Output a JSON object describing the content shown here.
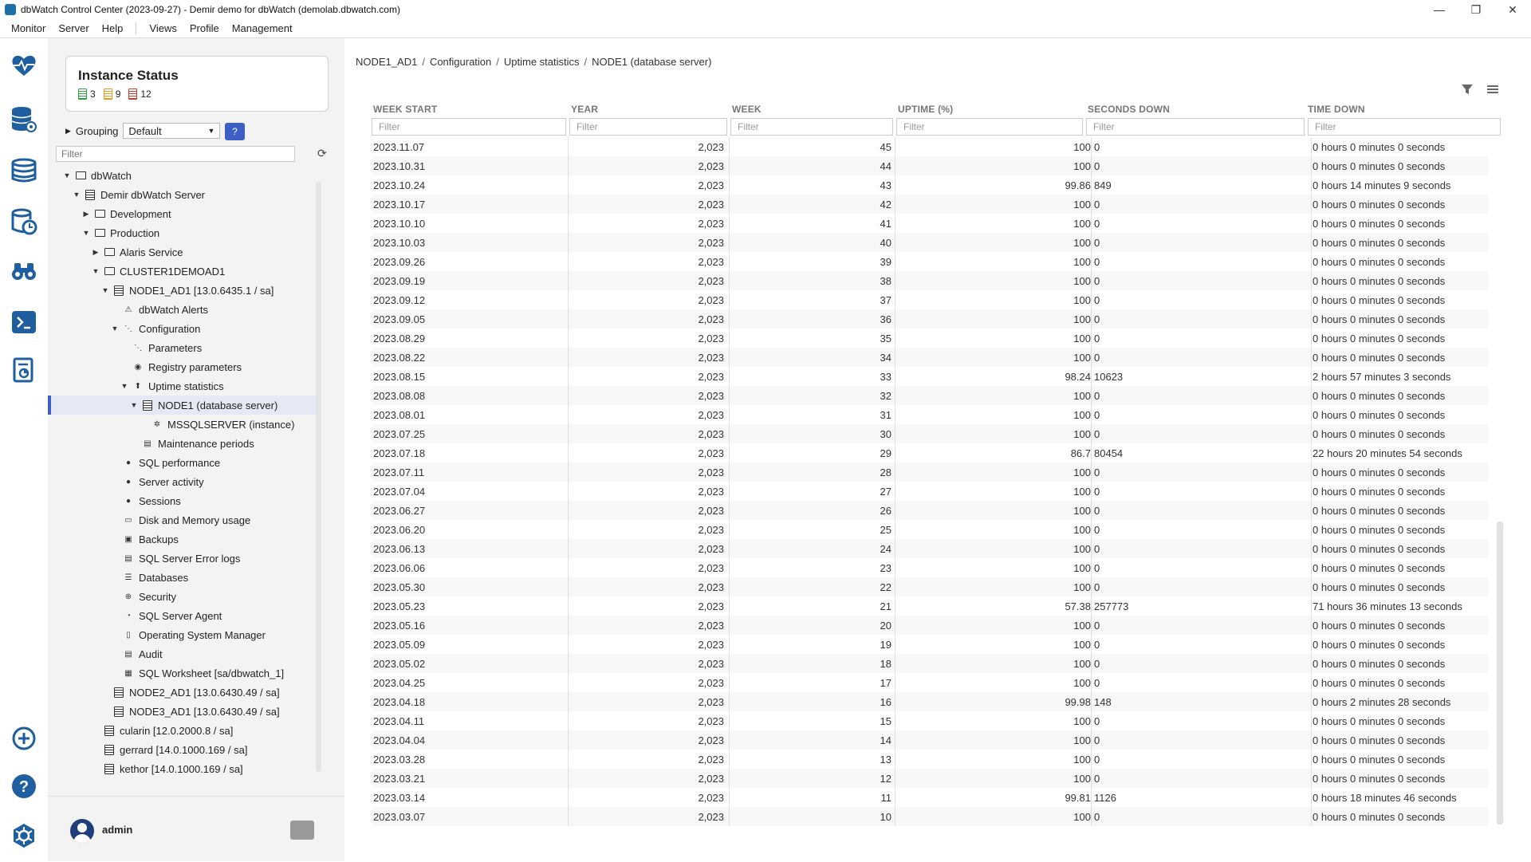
{
  "window": {
    "title": "dbWatch Control Center  (2023-09-27) - Demir demo for dbWatch (demolab.dbwatch.com)",
    "controls": [
      "—",
      "❐",
      "✕"
    ]
  },
  "menubar": {
    "items": [
      "Monitor",
      "Server",
      "Help"
    ],
    "items2": [
      "Views",
      "Profile",
      "Management"
    ]
  },
  "rail_icons": [
    "heartbeat-icon",
    "database-settings-icon",
    "database-stack-icon",
    "database-clock-icon",
    "binoculars-icon",
    "terminal-icon",
    "report-icon",
    "add-icon",
    "help-icon",
    "hexagon-settings-icon"
  ],
  "instance_status": {
    "title": "Instance Status",
    "green_count": "3",
    "orange_count": "9",
    "red_count": "12",
    "colors": {
      "green": "#2e9e44",
      "orange": "#e89a1c",
      "red": "#d33b2c"
    }
  },
  "grouping": {
    "label": "Grouping",
    "selected": "Default",
    "help_label": "?"
  },
  "tree_filter": {
    "placeholder": "Filter"
  },
  "tree": [
    {
      "label": "dbWatch",
      "arrow": "▼",
      "icon": "folder"
    },
    {
      "label": "Demir dbWatch Server",
      "arrow": "▼",
      "icon": "db"
    },
    {
      "label": "Development",
      "arrow": "▶",
      "icon": "folder"
    },
    {
      "label": "Production",
      "arrow": "▼",
      "icon": "folder"
    },
    {
      "label": "Alaris Service",
      "arrow": "▶",
      "icon": "cluster"
    },
    {
      "label": "CLUSTER1DEMOAD1",
      "arrow": "▼",
      "icon": "cluster"
    },
    {
      "label": "NODE1_AD1 [13.0.6435.1 / sa]",
      "arrow": "▼",
      "icon": "db"
    },
    {
      "label": "dbWatch Alerts",
      "arrow": "",
      "icon": "alert"
    },
    {
      "label": "Configuration",
      "arrow": "▼",
      "icon": "config"
    },
    {
      "label": "Parameters",
      "arrow": "",
      "icon": "config"
    },
    {
      "label": "Registry parameters",
      "arrow": "",
      "icon": "registry"
    },
    {
      "label": "Uptime statistics",
      "arrow": "▼",
      "icon": "uptime"
    },
    {
      "label": "NODE1 (database server)",
      "arrow": "▼",
      "icon": "db"
    },
    {
      "label": "MSSQLSERVER (instance)",
      "arrow": "",
      "icon": "gear"
    },
    {
      "label": "Maintenance periods",
      "arrow": "",
      "icon": "doc"
    },
    {
      "label": "SQL performance",
      "arrow": "",
      "icon": "dot"
    },
    {
      "label": "Server activity",
      "arrow": "",
      "icon": "dot"
    },
    {
      "label": "Sessions",
      "arrow": "",
      "icon": "person"
    },
    {
      "label": "Disk and Memory usage",
      "arrow": "",
      "icon": "disk"
    },
    {
      "label": "Backups",
      "arrow": "",
      "icon": "backup"
    },
    {
      "label": "SQL Server Error logs",
      "arrow": "",
      "icon": "doc"
    },
    {
      "label": "Databases",
      "arrow": "",
      "icon": "databases"
    },
    {
      "label": "Security",
      "arrow": "",
      "icon": "globe"
    },
    {
      "label": "SQL Server Agent",
      "arrow": "",
      "icon": "clock"
    },
    {
      "label": "Operating System Manager",
      "arrow": "",
      "icon": "phone"
    },
    {
      "label": "Audit",
      "arrow": "",
      "icon": "doc"
    },
    {
      "label": "SQL Worksheet [sa/dbwatch_1]",
      "arrow": "",
      "icon": "worksheet"
    },
    {
      "label": "NODE2_AD1 [13.0.6430.49 / sa]",
      "arrow": "",
      "icon": "db"
    },
    {
      "label": "NODE3_AD1 [13.0.6430.49 / sa]",
      "arrow": "",
      "icon": "db"
    },
    {
      "label": "cularin [12.0.2000.8 / sa]",
      "arrow": "",
      "icon": "db"
    },
    {
      "label": "gerrard [14.0.1000.169 / sa]",
      "arrow": "",
      "icon": "db"
    },
    {
      "label": "kethor [14.0.1000.169 / sa]",
      "arrow": "",
      "icon": "db"
    }
  ],
  "user": {
    "name": "admin"
  },
  "breadcrumb": [
    "NODE1_AD1",
    "Configuration",
    "Uptime statistics",
    "NODE1 (database server)"
  ],
  "grid": {
    "columns": [
      "WEEK START",
      "YEAR",
      "WEEK",
      "UPTIME (%)",
      "SECONDS DOWN",
      "TIME DOWN"
    ],
    "filter_placeholder": "Filter",
    "rows": [
      [
        "2023.11.07",
        "2,023",
        "45",
        "100",
        "0",
        "0 hours 0 minutes 0 seconds"
      ],
      [
        "2023.10.31",
        "2,023",
        "44",
        "100",
        "0",
        "0 hours 0 minutes 0 seconds"
      ],
      [
        "2023.10.24",
        "2,023",
        "43",
        "99.86",
        "849",
        "0 hours 14 minutes 9 seconds"
      ],
      [
        "2023.10.17",
        "2,023",
        "42",
        "100",
        "0",
        "0 hours 0 minutes 0 seconds"
      ],
      [
        "2023.10.10",
        "2,023",
        "41",
        "100",
        "0",
        "0 hours 0 minutes 0 seconds"
      ],
      [
        "2023.10.03",
        "2,023",
        "40",
        "100",
        "0",
        "0 hours 0 minutes 0 seconds"
      ],
      [
        "2023.09.26",
        "2,023",
        "39",
        "100",
        "0",
        "0 hours 0 minutes 0 seconds"
      ],
      [
        "2023.09.19",
        "2,023",
        "38",
        "100",
        "0",
        "0 hours 0 minutes 0 seconds"
      ],
      [
        "2023.09.12",
        "2,023",
        "37",
        "100",
        "0",
        "0 hours 0 minutes 0 seconds"
      ],
      [
        "2023.09.05",
        "2,023",
        "36",
        "100",
        "0",
        "0 hours 0 minutes 0 seconds"
      ],
      [
        "2023.08.29",
        "2,023",
        "35",
        "100",
        "0",
        "0 hours 0 minutes 0 seconds"
      ],
      [
        "2023.08.22",
        "2,023",
        "34",
        "100",
        "0",
        "0 hours 0 minutes 0 seconds"
      ],
      [
        "2023.08.15",
        "2,023",
        "33",
        "98.24",
        "10623",
        "2 hours 57 minutes 3 seconds"
      ],
      [
        "2023.08.08",
        "2,023",
        "32",
        "100",
        "0",
        "0 hours 0 minutes 0 seconds"
      ],
      [
        "2023.08.01",
        "2,023",
        "31",
        "100",
        "0",
        "0 hours 0 minutes 0 seconds"
      ],
      [
        "2023.07.25",
        "2,023",
        "30",
        "100",
        "0",
        "0 hours 0 minutes 0 seconds"
      ],
      [
        "2023.07.18",
        "2,023",
        "29",
        "86.7",
        "80454",
        "22 hours 20 minutes 54 seconds"
      ],
      [
        "2023.07.11",
        "2,023",
        "28",
        "100",
        "0",
        "0 hours 0 minutes 0 seconds"
      ],
      [
        "2023.07.04",
        "2,023",
        "27",
        "100",
        "0",
        "0 hours 0 minutes 0 seconds"
      ],
      [
        "2023.06.27",
        "2,023",
        "26",
        "100",
        "0",
        "0 hours 0 minutes 0 seconds"
      ],
      [
        "2023.06.20",
        "2,023",
        "25",
        "100",
        "0",
        "0 hours 0 minutes 0 seconds"
      ],
      [
        "2023.06.13",
        "2,023",
        "24",
        "100",
        "0",
        "0 hours 0 minutes 0 seconds"
      ],
      [
        "2023.06.06",
        "2,023",
        "23",
        "100",
        "0",
        "0 hours 0 minutes 0 seconds"
      ],
      [
        "2023.05.30",
        "2,023",
        "22",
        "100",
        "0",
        "0 hours 0 minutes 0 seconds"
      ],
      [
        "2023.05.23",
        "2,023",
        "21",
        "57.38",
        "257773",
        "71 hours 36 minutes 13 seconds"
      ],
      [
        "2023.05.16",
        "2,023",
        "20",
        "100",
        "0",
        "0 hours 0 minutes 0 seconds"
      ],
      [
        "2023.05.09",
        "2,023",
        "19",
        "100",
        "0",
        "0 hours 0 minutes 0 seconds"
      ],
      [
        "2023.05.02",
        "2,023",
        "18",
        "100",
        "0",
        "0 hours 0 minutes 0 seconds"
      ],
      [
        "2023.04.25",
        "2,023",
        "17",
        "100",
        "0",
        "0 hours 0 minutes 0 seconds"
      ],
      [
        "2023.04.18",
        "2,023",
        "16",
        "99.98",
        "148",
        "0 hours 2 minutes 28 seconds"
      ],
      [
        "2023.04.11",
        "2,023",
        "15",
        "100",
        "0",
        "0 hours 0 minutes 0 seconds"
      ],
      [
        "2023.04.04",
        "2,023",
        "14",
        "100",
        "0",
        "0 hours 0 minutes 0 seconds"
      ],
      [
        "2023.03.28",
        "2,023",
        "13",
        "100",
        "0",
        "0 hours 0 minutes 0 seconds"
      ],
      [
        "2023.03.21",
        "2,023",
        "12",
        "100",
        "0",
        "0 hours 0 minutes 0 seconds"
      ],
      [
        "2023.03.14",
        "2,023",
        "11",
        "99.81",
        "1126",
        "0 hours 18 minutes 46 seconds"
      ],
      [
        "2023.03.07",
        "2,023",
        "10",
        "100",
        "0",
        "0 hours 0 minutes 0 seconds"
      ]
    ]
  }
}
